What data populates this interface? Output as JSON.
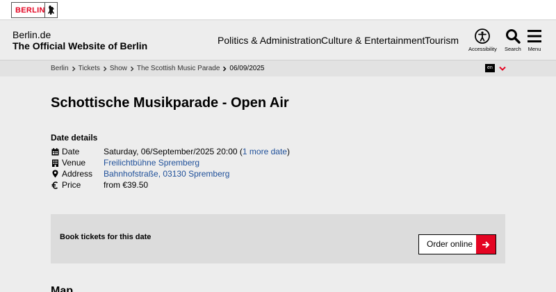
{
  "logo": {
    "text": "BERLIN",
    "emblem_icon": "bear-icon"
  },
  "header": {
    "site_name": "Berlin.de",
    "site_subtitle": "The Official Website of Berlin",
    "nav": [
      {
        "label": "Politics & Administration"
      },
      {
        "label": "Culture & Entertainment"
      },
      {
        "label": "Tourism"
      }
    ],
    "utilities": {
      "accessibility": {
        "label": "Accessibility",
        "icon": "accessibility-icon"
      },
      "search": {
        "label": "Search",
        "icon": "search-icon"
      },
      "menu": {
        "label": "Menu",
        "icon": "hamburger-menu-icon"
      }
    }
  },
  "breadcrumb": {
    "items": [
      "Berlin",
      "Tickets",
      "Show",
      "The Scottish Music Parade",
      "06/09/2025"
    ],
    "language": "en",
    "language_icon": "chevron-down-icon"
  },
  "event": {
    "title": "Schottische Musikparade - Open Air",
    "details_heading": "Date details",
    "details": {
      "date": {
        "label": "Date",
        "value": "Saturday, 06/September/2025 20:00 (",
        "more_link": "1 more date",
        "close": ")",
        "icon": "calendar-icon"
      },
      "venue": {
        "label": "Venue",
        "value": "Freilichtbühne Spremberg",
        "icon": "building-icon"
      },
      "address": {
        "label": "Address",
        "value": "Bahnhofstraße, 03130 Spremberg",
        "icon": "map-pin-icon"
      },
      "price": {
        "label": "Price",
        "value": "from €39.50",
        "icon": "euro-icon"
      }
    }
  },
  "booking": {
    "label": "Book tickets for this date",
    "button_label": "Order online",
    "button_icon": "arrow-right-icon"
  },
  "map": {
    "heading": "Map"
  },
  "colors": {
    "brand_red": "#e40422",
    "link_blue": "#1e4f99"
  }
}
